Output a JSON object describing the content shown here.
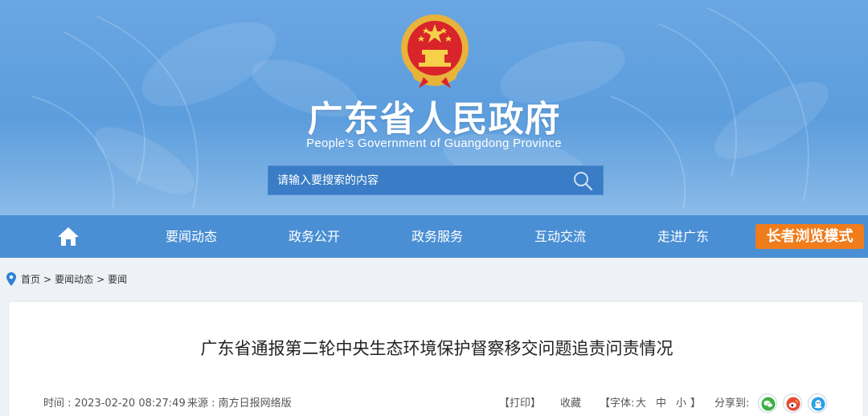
{
  "header": {
    "title": "广东省人民政府",
    "subtitle": "People's Government of Guangdong Province",
    "emblem_icon": "national-emblem-icon"
  },
  "search": {
    "placeholder": "请输入要搜索的内容"
  },
  "nav": {
    "home_icon": "home-icon",
    "items": [
      {
        "label": "要闻动态"
      },
      {
        "label": "政务公开"
      },
      {
        "label": "政务服务"
      },
      {
        "label": "互动交流"
      },
      {
        "label": "走进广东"
      }
    ],
    "elder_mode_label": "长者浏览模式"
  },
  "breadcrumb": {
    "items": [
      "首页",
      "要闻动态",
      "要闻"
    ],
    "separator": ">"
  },
  "article": {
    "title": "广东省通报第二轮中央生态环境保护督察移交问题追责问责情况",
    "time": "时间 : 2023-02-20 08:27:49",
    "source": "来源 : 南方日报网络版",
    "print_label": "【打印】",
    "favorite_label": "收藏",
    "font_size_label": "【字体:",
    "font_sizes": [
      "大",
      "中",
      "小"
    ],
    "font_size_close": "】",
    "share_label": "分享到:",
    "share_icons": [
      "wechat-icon",
      "weibo-icon",
      "qq-icon"
    ]
  },
  "colors": {
    "banner_top": "#6aa6e2",
    "nav_bg": "#4a8fd4",
    "search_bg": "#3a7dc6",
    "elder_btn": "#f07c1b",
    "page_bg": "#eef1f5"
  }
}
